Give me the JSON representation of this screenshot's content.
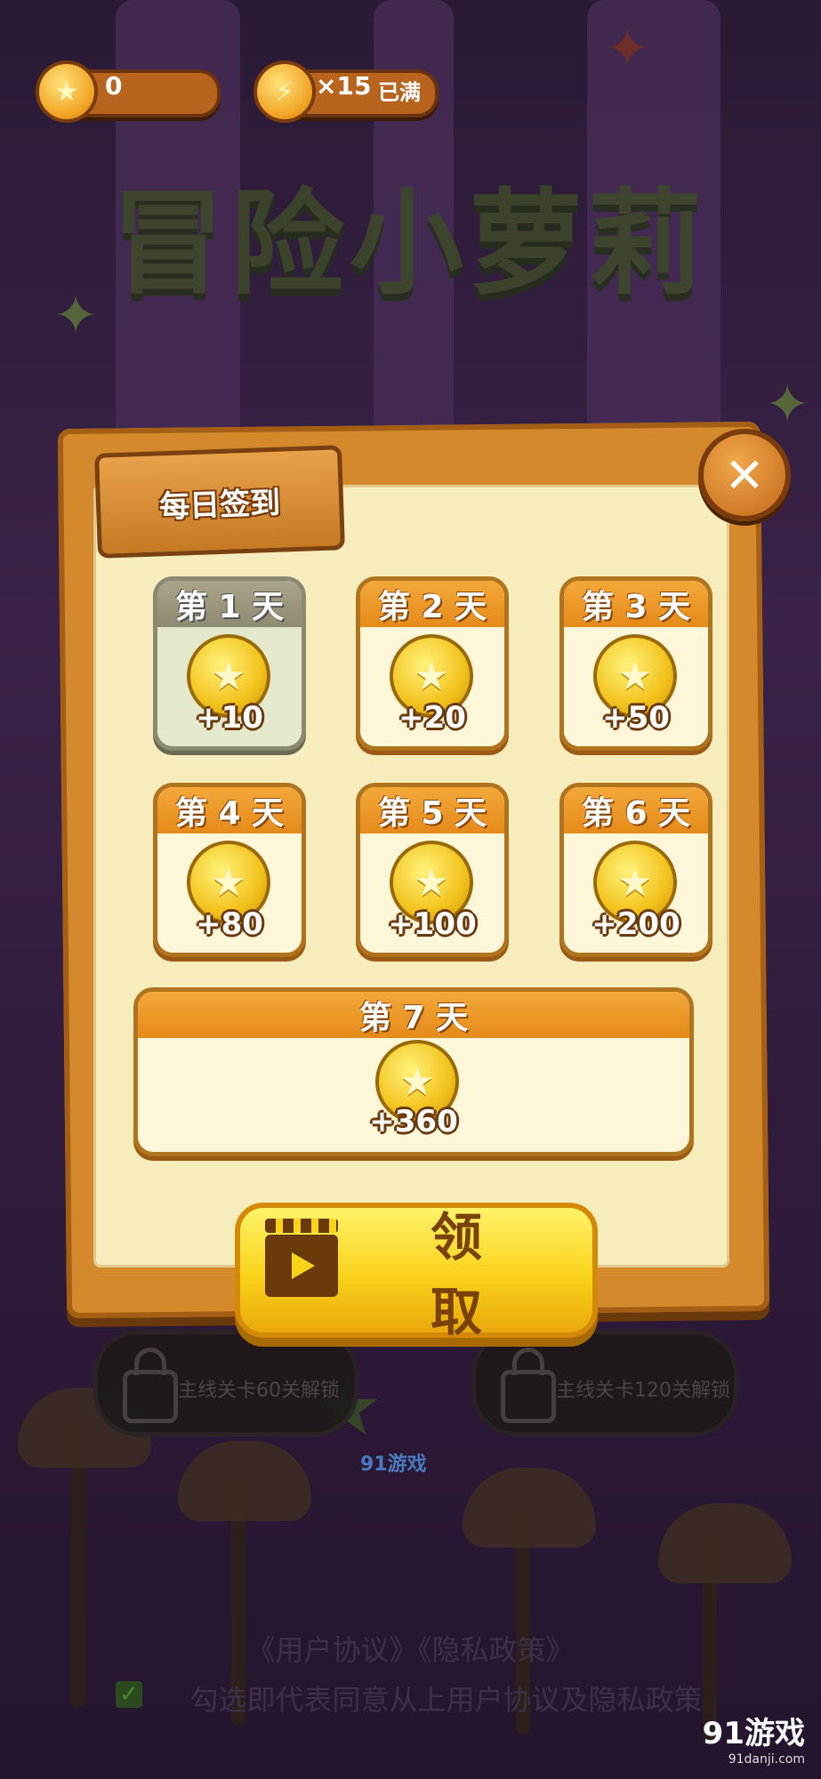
{
  "topbar": {
    "coins": "0",
    "energy": "×15",
    "energy_status": "已满"
  },
  "game_title": "冒险小萝莉",
  "dialog": {
    "title": "每日签到",
    "close_icon": "close-icon",
    "days": [
      {
        "label": "第 1 天",
        "reward": "+10"
      },
      {
        "label": "第 2 天",
        "reward": "+20"
      },
      {
        "label": "第 3 天",
        "reward": "+50"
      },
      {
        "label": "第 4 天",
        "reward": "+80"
      },
      {
        "label": "第 5 天",
        "reward": "+100"
      },
      {
        "label": "第 6 天",
        "reward": "+200"
      },
      {
        "label": "第 7 天",
        "reward": "+360"
      }
    ],
    "claimed_days": 1,
    "claim_label": "领 取"
  },
  "modes": {
    "left_lock_text": "主线关卡60关解锁",
    "right_lock_text": "主线关卡120关解锁"
  },
  "footer": {
    "links": "《用户协议》《隐私政策》",
    "agreement": "勾选即代表同意从上用户协议及隐私政策"
  },
  "watermark": {
    "center": "91游戏",
    "brand": "91游戏",
    "brand_url": "91danji.com"
  },
  "colors": {
    "accent": "#f2c21c",
    "board": "#d48a2c",
    "paper": "#f6ecbc"
  }
}
